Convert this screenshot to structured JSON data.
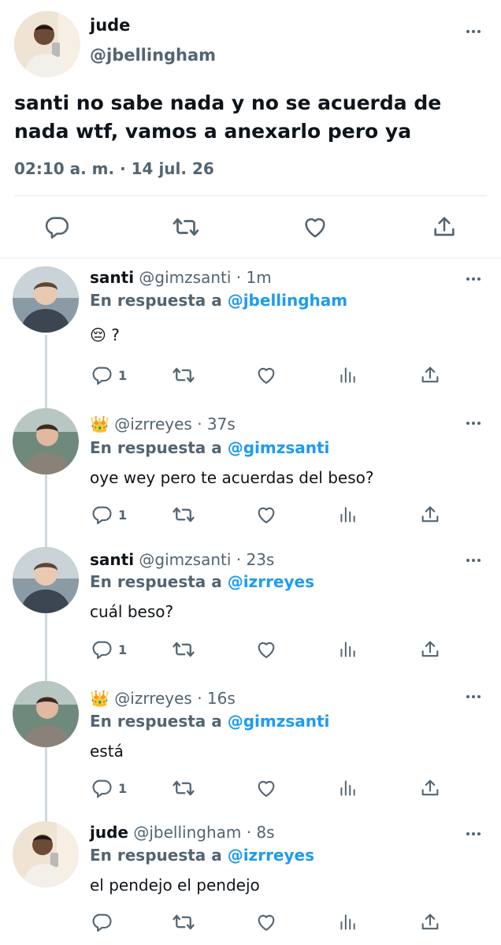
{
  "main": {
    "name": "jude",
    "handle": "@jbellingham",
    "text": "santi no sabe nada y no se acuerda de nada wtf, vamos a anexarlo pero ya",
    "timestamp": "02:10 a. m. · 14 jul. 26"
  },
  "replies": [
    {
      "name": "santi",
      "handle": "@gimzsanti",
      "time": " · 1m",
      "reply_prefix": "En respuesta a ",
      "reply_to": "@jbellingham",
      "text": "😔 ?",
      "reply_count": "1"
    },
    {
      "name": "👑",
      "handle": "@izrreyes",
      "time": " · 37s",
      "reply_prefix": "En respuesta a ",
      "reply_to": "@gimzsanti",
      "text": "oye wey pero te acuerdas del beso?",
      "reply_count": "1"
    },
    {
      "name": "santi",
      "handle": "@gimzsanti",
      "time": " · 23s",
      "reply_prefix": "En respuesta a ",
      "reply_to": "@izrreyes",
      "text": "cuál beso?",
      "reply_count": "1"
    },
    {
      "name": "👑",
      "handle": "@izrreyes",
      "time": " · 16s",
      "reply_prefix": "En respuesta a ",
      "reply_to": "@gimzsanti",
      "text": "está",
      "reply_count": "1"
    },
    {
      "name": "jude",
      "handle": "@jbellingham",
      "time": " · 8s",
      "reply_prefix": "En respuesta a ",
      "reply_to": "@izrreyes",
      "text": "el pendejo el pendejo",
      "reply_count": ""
    }
  ],
  "colors": {
    "text": "#0f1419",
    "secondary": "#536471",
    "link": "#1d9bf0",
    "divider": "#e6e9eb",
    "thread_line": "#cfd9de"
  },
  "icons": [
    "more-icon",
    "reply-icon",
    "retweet-icon",
    "like-icon",
    "share-icon",
    "views-icon"
  ]
}
